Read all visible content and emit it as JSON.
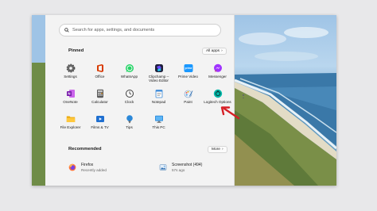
{
  "search": {
    "placeholder": "Search for apps, settings, and documents"
  },
  "pinned": {
    "title": "Pinned",
    "all_apps_label": "All apps",
    "apps": [
      {
        "label": "Settings",
        "icon": "gear-icon"
      },
      {
        "label": "Office",
        "icon": "office-icon"
      },
      {
        "label": "WhatsApp",
        "icon": "whatsapp-icon"
      },
      {
        "label": "Clipchamp – Video Editor",
        "icon": "clipchamp-icon"
      },
      {
        "label": "Prime Video",
        "icon": "prime-video-icon"
      },
      {
        "label": "Messenger",
        "icon": "messenger-icon"
      },
      {
        "label": "OneNote",
        "icon": "onenote-icon"
      },
      {
        "label": "Calculator",
        "icon": "calculator-icon"
      },
      {
        "label": "Clock",
        "icon": "clock-icon"
      },
      {
        "label": "Notepad",
        "icon": "notepad-icon"
      },
      {
        "label": "Paint",
        "icon": "paint-icon"
      },
      {
        "label": "Logitech Options",
        "icon": "logitech-icon"
      },
      {
        "label": "File Explorer",
        "icon": "folder-icon"
      },
      {
        "label": "Films & TV",
        "icon": "films-tv-icon"
      },
      {
        "label": "Tips",
        "icon": "tips-icon"
      },
      {
        "label": "This PC",
        "icon": "this-pc-icon"
      }
    ]
  },
  "recommended": {
    "title": "Recommended",
    "more_label": "More",
    "items": [
      {
        "name": "Firefox",
        "sub": "Recently added",
        "icon": "firefox-icon"
      },
      {
        "name": "Screenshot (494)",
        "sub": "57s ago",
        "icon": "image-file-icon"
      }
    ]
  },
  "colors": {
    "accent": "#0067c0",
    "annotation_arrow": "#d61f26",
    "panel": "#f3f3f3"
  }
}
